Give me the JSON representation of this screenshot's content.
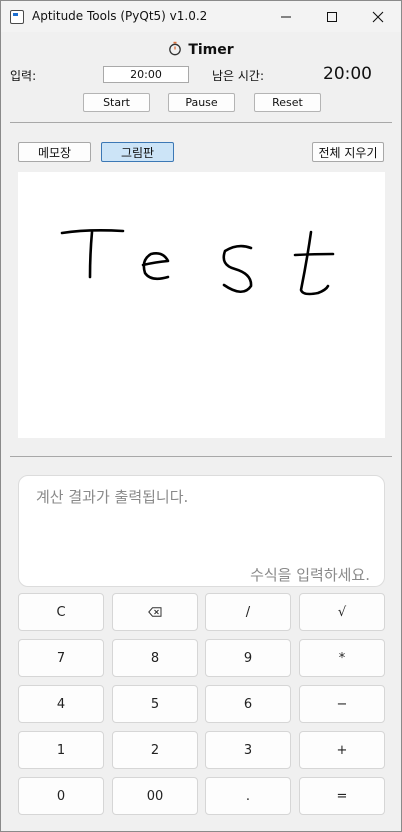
{
  "window": {
    "title": "Aptitude Tools (PyQt5) v1.0.2",
    "controls": [
      "minimize-icon",
      "maximize-icon",
      "close-icon"
    ]
  },
  "timer": {
    "title": "Timer",
    "input_label": "입력:",
    "input_value": "20:00",
    "remaining_label": "남은 시간:",
    "remaining_value": "20:00",
    "start_label": "Start",
    "pause_label": "Pause",
    "reset_label": "Reset"
  },
  "pad": {
    "memo_tab": "메모장",
    "draw_tab": "그림판",
    "active_tab": "그림판",
    "clear_label": "전체 지우기",
    "stroke_color": "#000000"
  },
  "calculator": {
    "result_placeholder": "계산 결과가 출력됩니다.",
    "expression_placeholder": "수식을 입력하세요.",
    "keys": [
      [
        "C",
        "⌫",
        "/",
        "√"
      ],
      [
        "7",
        "8",
        "9",
        "*"
      ],
      [
        "4",
        "5",
        "6",
        "−"
      ],
      [
        "1",
        "2",
        "3",
        "+"
      ],
      [
        "0",
        "00",
        ".",
        "="
      ]
    ]
  },
  "colors": {
    "window_bg": "#f0f0f0",
    "active_tab_bg": "#cce4f7",
    "active_tab_border": "#3c78b5",
    "placeholder_text": "#8a8a8a"
  }
}
